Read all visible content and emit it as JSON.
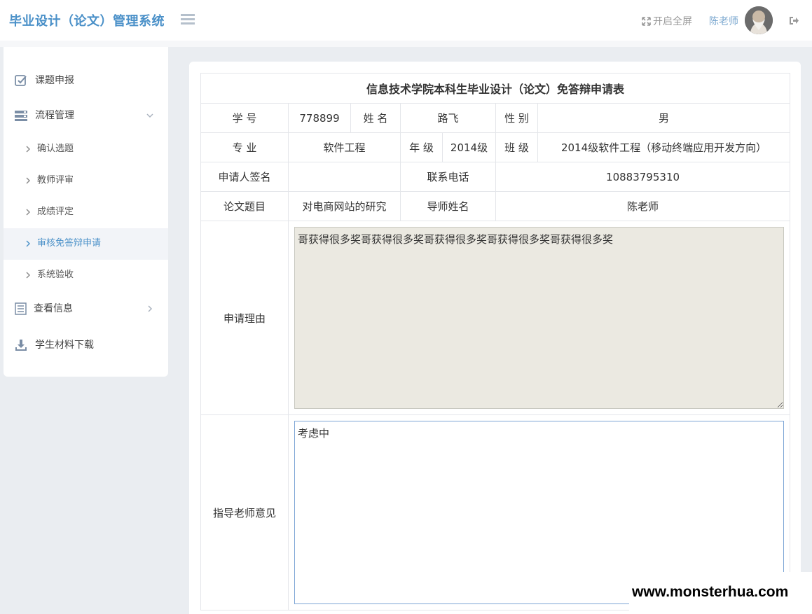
{
  "header": {
    "app_title": "毕业设计（论文）管理系统",
    "fullscreen_label": "开启全屏",
    "username": "陈老师"
  },
  "sidebar": {
    "items": [
      {
        "label": "课题申报",
        "icon": "check-square-icon"
      },
      {
        "label": "流程管理",
        "icon": "server-icon",
        "expanded": true,
        "children": [
          {
            "label": "确认选题"
          },
          {
            "label": "教师评审"
          },
          {
            "label": "成绩评定"
          },
          {
            "label": "审核免答辩申请",
            "active": true
          },
          {
            "label": "系统验收"
          }
        ]
      },
      {
        "label": "查看信息",
        "icon": "list-icon"
      },
      {
        "label": "学生材料下载",
        "icon": "download-icon"
      }
    ]
  },
  "form": {
    "title": "信息技术学院本科生毕业设计（论文）免答辩申请表",
    "student_id_label": "学 号",
    "student_id": "778899",
    "name_label": "姓 名",
    "name": "路飞",
    "gender_label": "性 别",
    "gender": "男",
    "major_label": "专 业",
    "major": "软件工程",
    "grade_label": "年 级",
    "grade": "2014级",
    "class_label": "班 级",
    "class": "2014级软件工程（移动终端应用开发方向）",
    "signature_label": "申请人签名",
    "signature": "",
    "phone_label": "联系电话",
    "phone": "10883795310",
    "thesis_label": "论文题目",
    "thesis": "对电商网站的研究",
    "advisor_label": "导师姓名",
    "advisor": "陈老师",
    "reason_label": "申请理由",
    "reason": "哥获得很多奖哥获得很多奖哥获得很多奖哥获得很多奖哥获得很多奖",
    "opinion_label": "指导老师意见",
    "opinion": "考虑中"
  },
  "watermark": "www.monsterhua.com",
  "colors": {
    "brand": "#4a90c8",
    "page_bg": "#eaedf1",
    "readonly_textarea": "#ebe9e1",
    "focus_border": "#7ea6d6"
  }
}
